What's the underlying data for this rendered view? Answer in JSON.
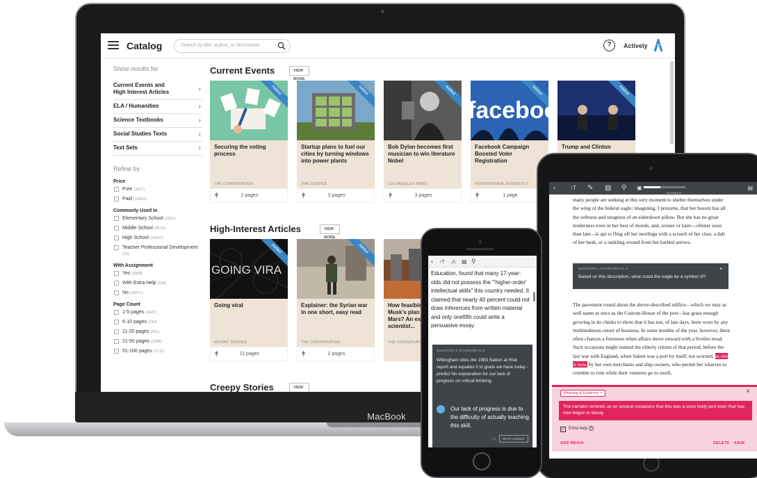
{
  "laptop": {
    "brand_text": "MacBook",
    "header": {
      "title": "Catalog",
      "search_placeholder": "Search by title, author, or description",
      "help_label": "?",
      "brand": "Actively"
    },
    "sidebar": {
      "show_results_for": "Show results for",
      "categories": [
        {
          "label": "Current Events and\nHigh Interest Articles"
        },
        {
          "label": "ELA / Humanities"
        },
        {
          "label": "Science Textbooks"
        },
        {
          "label": "Social Studies Texts"
        },
        {
          "label": "Text Sets"
        }
      ],
      "refine_by": "Refine by",
      "filters": [
        {
          "title": "Price",
          "options": [
            {
              "label": "Free",
              "count": "(3927)"
            },
            {
              "label": "Paid",
              "count": "(15852)"
            }
          ]
        },
        {
          "title": "Commonly Used In",
          "options": [
            {
              "label": "Elementary School",
              "count": "(2261)"
            },
            {
              "label": "Middle School",
              "count": "(5576)"
            },
            {
              "label": "High School",
              "count": "(13067)"
            },
            {
              "label": "Teacher Professional Development",
              "count": "(10)"
            }
          ]
        },
        {
          "title": "With Assignment",
          "options": [
            {
              "label": "Yes",
              "count": "(2908)"
            },
            {
              "label": "With Extra Help",
              "count": "(159)"
            },
            {
              "label": "No",
              "count": "(16871)"
            }
          ]
        },
        {
          "title": "Page Count",
          "options": [
            {
              "label": "1-5 pages",
              "count": "(3647)"
            },
            {
              "label": "6-10 pages",
              "count": "(214)"
            },
            {
              "label": "11-20 pages",
              "count": "(321)"
            },
            {
              "label": "21-50 pages",
              "count": "(1065)"
            },
            {
              "label": "51-100 pages",
              "count": "(1711)"
            }
          ]
        }
      ]
    },
    "sections": [
      {
        "title": "Current Events",
        "view_more": "VIEW MORE",
        "cards": [
          {
            "title": "Securing the voting process",
            "source": "THE CONVERSATION",
            "pages": "2 pages",
            "ribbon": "Added"
          },
          {
            "title": "Startup plans to fuel our cities by turning windows into power plants",
            "source": "ZME SCIENCE",
            "pages": "3 pages",
            "ribbon": "Added"
          },
          {
            "title": "Bob Dylan becomes first musician to win literature Nobel",
            "source": "LOS ANGELES TIMES",
            "pages": "3 pages",
            "ribbon": "Added"
          },
          {
            "title": "Facebook Campaign Boosted Voter Registration",
            "source": "INTERNATIONAL BUSINESS T",
            "pages": "1 page",
            "ribbon": "Added"
          },
          {
            "title": "Trump and Clinton",
            "source": "",
            "pages": "",
            "ribbon": "Added"
          }
        ]
      },
      {
        "title": "High-Interest Articles",
        "view_more": "VIEW MORE",
        "cards": [
          {
            "title": "Going viral",
            "source": "MOSAIC SCIENCE",
            "pages": "11 pages",
            "ribbon": "Added",
            "img_text": "GOING VIRA"
          },
          {
            "title": "Explainer: the Syrian war in one short, easy read",
            "source": "THE CONVERSATION",
            "pages": "2 pages",
            "ribbon": "Added"
          },
          {
            "title": "How feasible is Elon Musk's plan to live on Mars? An expert scientist...",
            "source": "THE CONVERSATION",
            "pages": "",
            "ribbon": "Added"
          }
        ]
      },
      {
        "title": "Creepy Stories",
        "view_more": "VIEW MORE"
      }
    ]
  },
  "tablet": {
    "toolbar_progress": "Too Many To",
    "paragraph1": "many people are seeking at this very moment to shelter themselves under the wing of the federal eagle; imagining, I presume, that her bosom has all the softness and snugness of an eiderdown pillow. But she has no great tenderness even in her best of moods, and, sooner or later—oftener soon than late—is apt to fling off her nestlings with a scratch of her claw, a dab of her beak, or a rankling wound from her barbed arrows.",
    "question_header": "QUESTION 1    STANDARD RL.4",
    "question_text": "Based on this description, what could the eagle be a symbol of?",
    "paragraph2_before": "The pavement round about the above-described edifice—which we may as well name at once as the Custom-House of the port—has grass enough growing in its chinks to show that it has not, of late days, been worn by any multitudinous resort of business. In some months of the year, however, there often chances a forenoon when affairs move onward with a livelier tread. Such occasions might remind the elderly citizen of that period, before the last war with England, when Salem was a port by itself; not scorned, ",
    "paragraph2_highlight": "as she is now,",
    "paragraph2_after": " by her own merchants and ship-owners, who permit her wharves to crumble to ruin while their ventures go to swell,",
    "note": {
      "tag": "Meaning & Evidence",
      "comment": "The narrator reminds us on several occasions that this was a once lively port town that has now begun to decay.",
      "extra_help": "Extra help",
      "add_media": "ADD MEDIA",
      "delete": "DELETE",
      "save": "SAVE"
    }
  },
  "phone": {
    "passage": "Education, found that many 17-year-olds did not possess the \"'higher-order' intellectual skills\" this country needed. It claimed that nearly 40 percent could not draw inferences from written material and only onefifth could write a persuasive essay.",
    "question_header": "QUESTION 1    STANDARD RI.2",
    "question_text": "Willingham cites the 1983 Nation at Risk report and equates it to goals we have today - predict his explanation for our lack of progress on critical thinking.",
    "answer": "Our lack of progress is due to the difficulty of actually teaching this skill.",
    "likes": "0",
    "retry": "RETRY ANSWER"
  },
  "colors": {
    "accent_blue": "#3a86c4",
    "highlight_pink": "#e0245e",
    "note_bg": "#f8d3de",
    "question_bg": "#3f4449",
    "card_bg": "#efe3d6"
  }
}
